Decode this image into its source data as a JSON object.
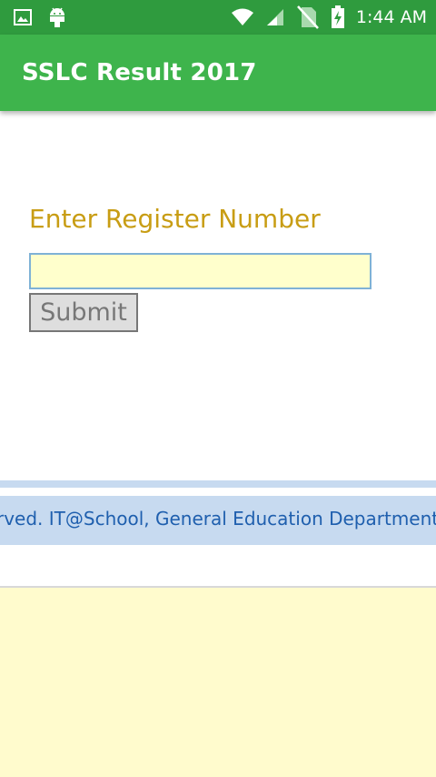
{
  "status_bar": {
    "time": "1:44 AM",
    "icons": [
      "image-icon",
      "android-icon",
      "wifi-icon",
      "signal-icon",
      "no-sim-icon",
      "battery-charging-icon"
    ]
  },
  "app_bar": {
    "title": "SSLC Result 2017"
  },
  "form": {
    "label": "Enter Register Number",
    "input_value": "",
    "submit_label": "Submit"
  },
  "footer": {
    "text": "rved. IT@School, General Education Department, G"
  },
  "colors": {
    "status_bar": "#2f9b3e",
    "app_bar": "#3eb44c",
    "label": "#c89d14",
    "input_bg": "#ffffcc",
    "footer_bg": "#c7daf0",
    "footer_text": "#1f5fae",
    "bottom_panel": "#fffbcd"
  }
}
